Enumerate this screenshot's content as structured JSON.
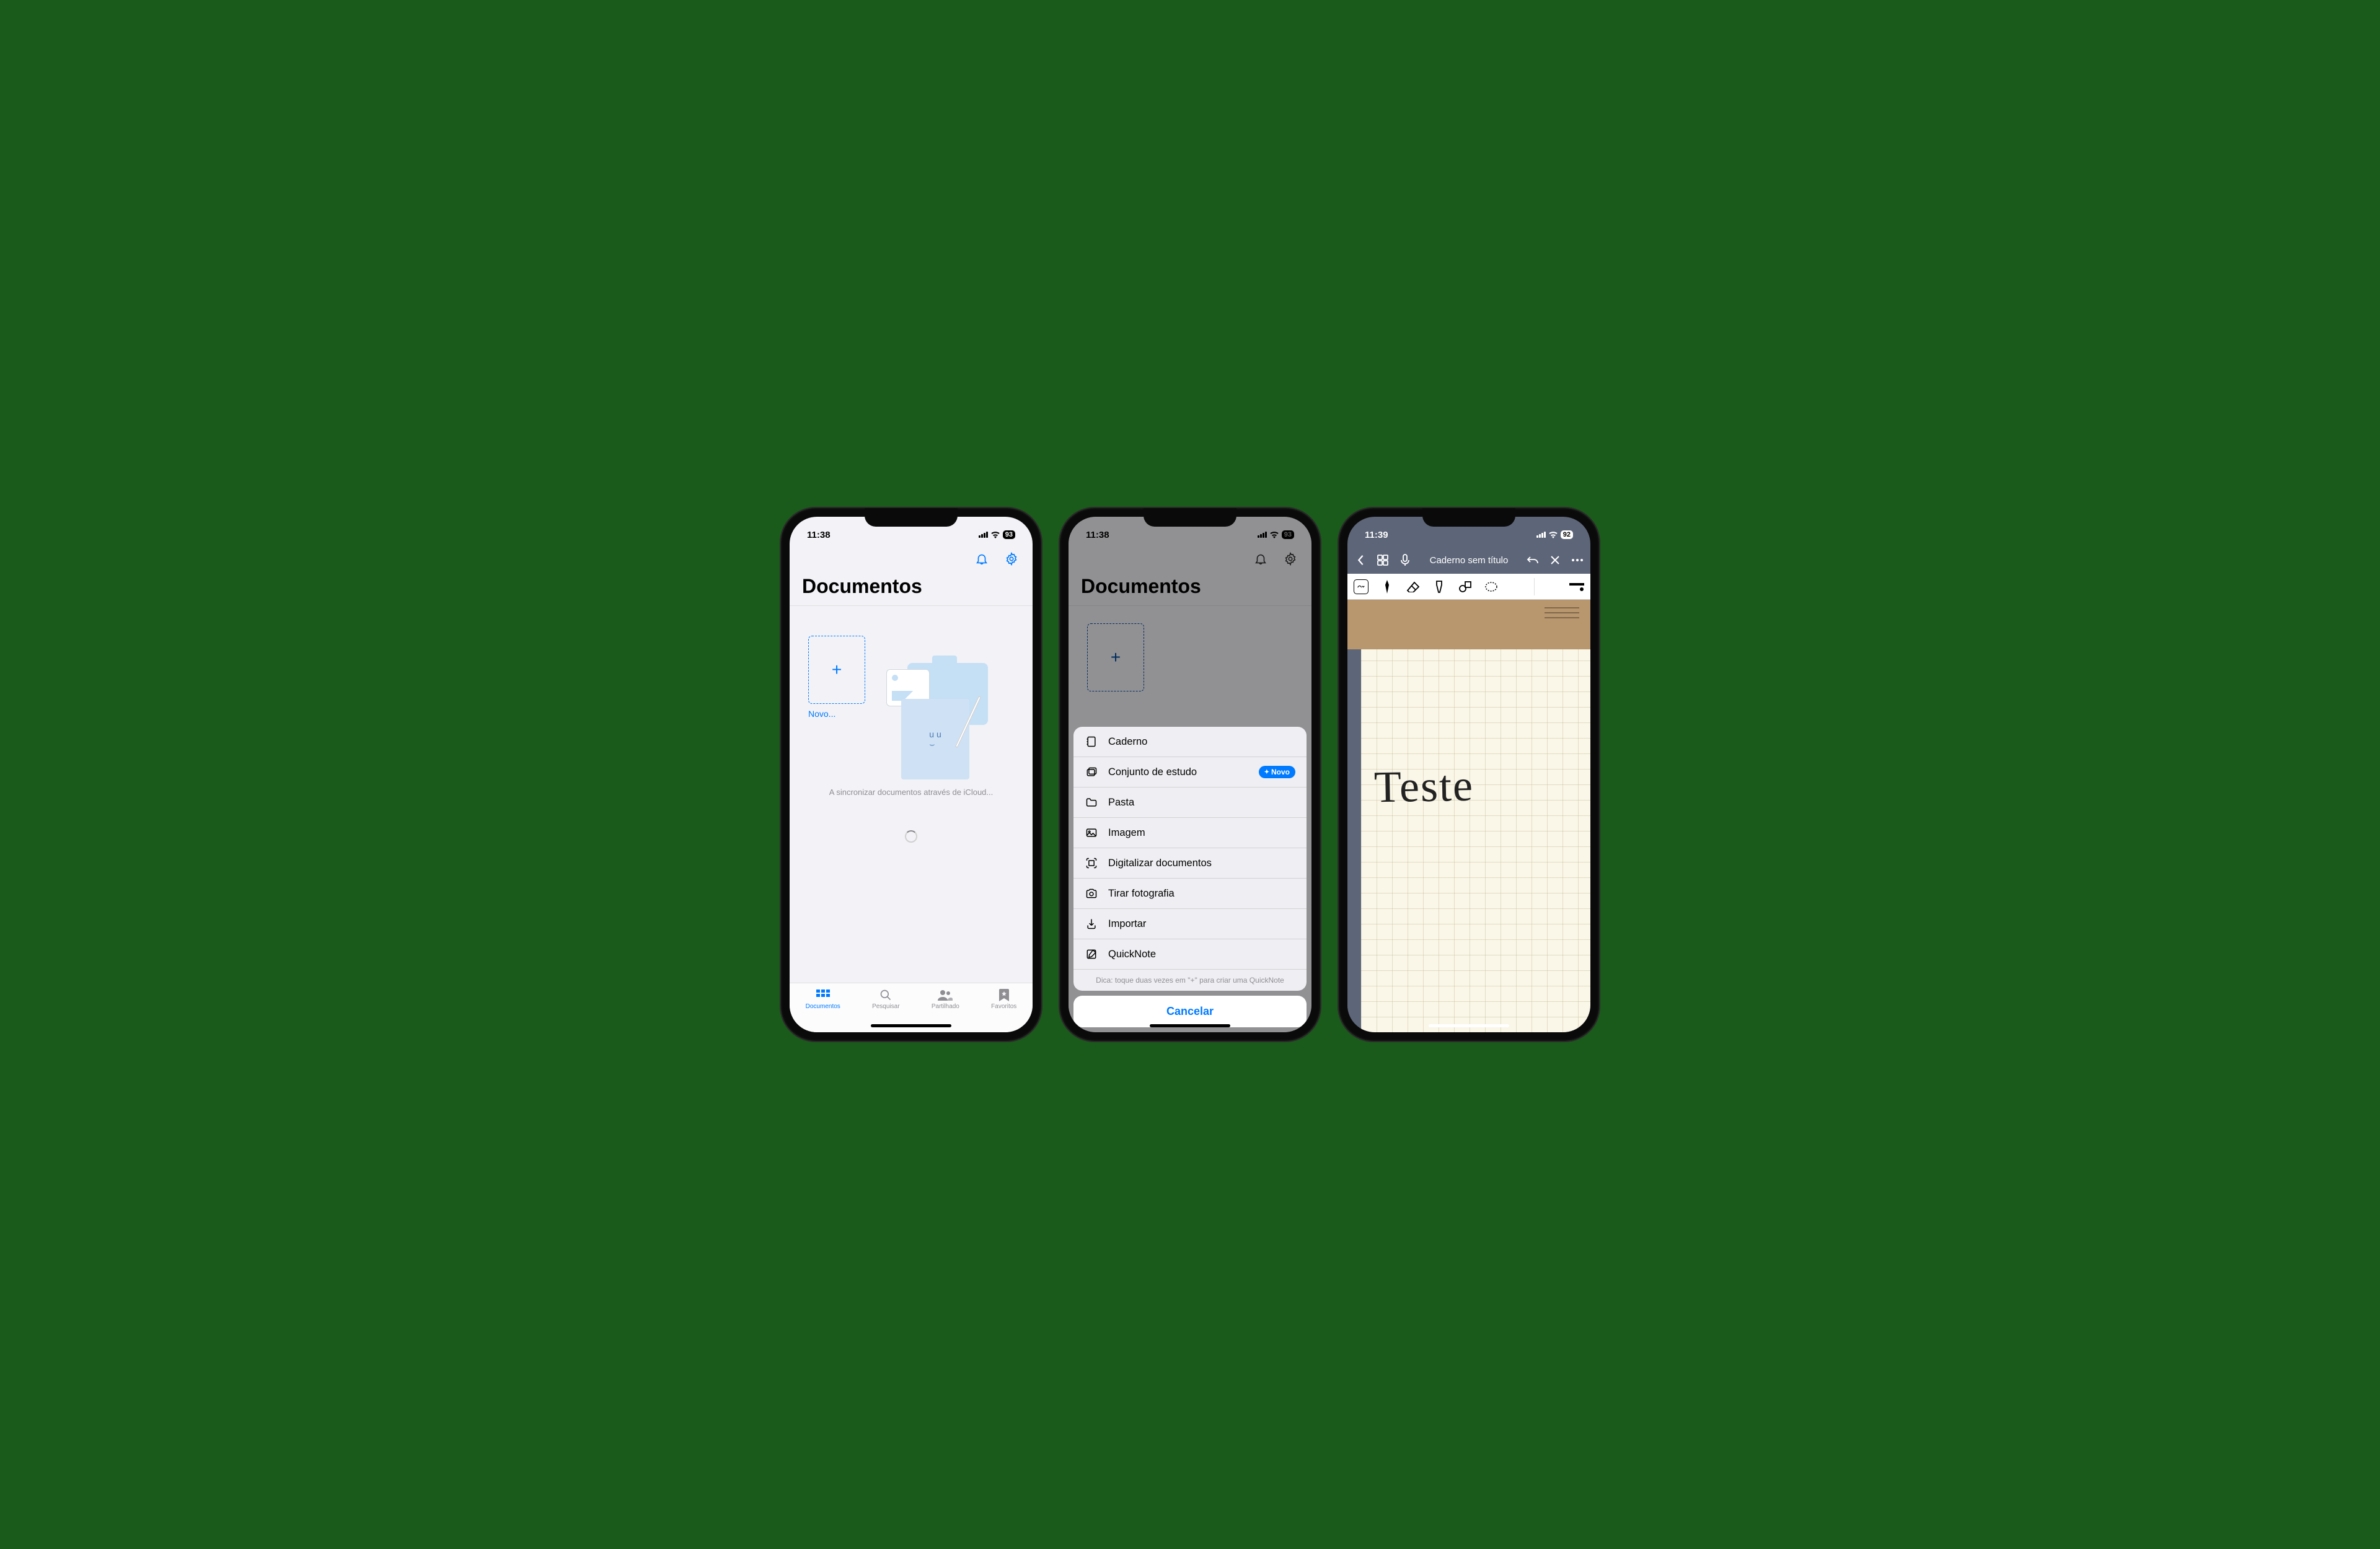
{
  "screen1": {
    "time": "11:38",
    "battery": "93",
    "title": "Documentos",
    "new_label": "Novo...",
    "sync_text": "A sincronizar documentos através de iCloud...",
    "tabs": {
      "documents": "Documentos",
      "search": "Pesquisar",
      "shared": "Partilhado",
      "favorites": "Favoritos"
    }
  },
  "screen2": {
    "time": "11:38",
    "battery": "93",
    "title": "Documentos",
    "menu": {
      "notebook": "Caderno",
      "study_set": "Conjunto de estudo",
      "folder": "Pasta",
      "image": "Imagem",
      "scan": "Digitalizar documentos",
      "photo": "Tirar fotografia",
      "import": "Importar",
      "quicknote": "QuickNote",
      "badge_new": "Novo",
      "hint": "Dica: toque duas vezes em \"+\" para criar uma QuickNote",
      "cancel": "Cancelar"
    }
  },
  "screen3": {
    "time": "11:39",
    "battery": "92",
    "title": "Caderno sem título",
    "handwriting": "Teste"
  }
}
